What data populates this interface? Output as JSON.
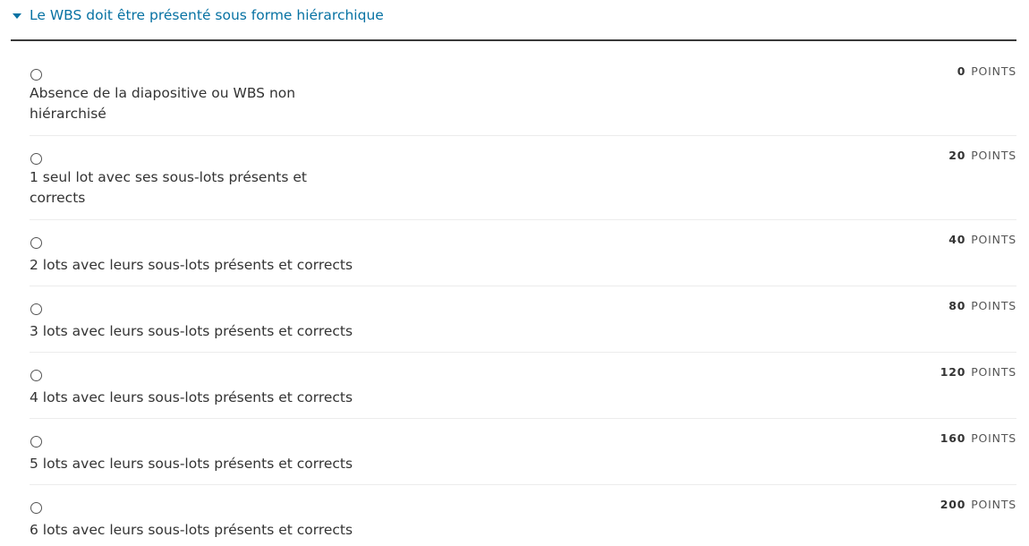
{
  "section": {
    "title": "Le WBS doit être présenté sous forme hiérarchique",
    "expanded": true,
    "accent_color": "#0772a3"
  },
  "options": [
    {
      "label": "Absence de la diapositive ou WBS non hiérarchisé",
      "points": "0",
      "unit": "POINTS",
      "selected": false
    },
    {
      "label": "1 seul lot avec ses sous-lots présents et corrects",
      "points": "20",
      "unit": "POINTS",
      "selected": false
    },
    {
      "label": "2 lots avec leurs sous-lots présents et corrects",
      "points": "40",
      "unit": "POINTS",
      "selected": false
    },
    {
      "label": "3 lots avec leurs sous-lots présents et corrects",
      "points": "80",
      "unit": "POINTS",
      "selected": false
    },
    {
      "label": "4 lots avec leurs sous-lots présents et corrects",
      "points": "120",
      "unit": "POINTS",
      "selected": false
    },
    {
      "label": "5 lots avec leurs sous-lots présents et corrects",
      "points": "160",
      "unit": "POINTS",
      "selected": false
    },
    {
      "label": "6 lots avec leurs sous-lots présents et corrects",
      "points": "200",
      "unit": "POINTS",
      "selected": false
    }
  ]
}
